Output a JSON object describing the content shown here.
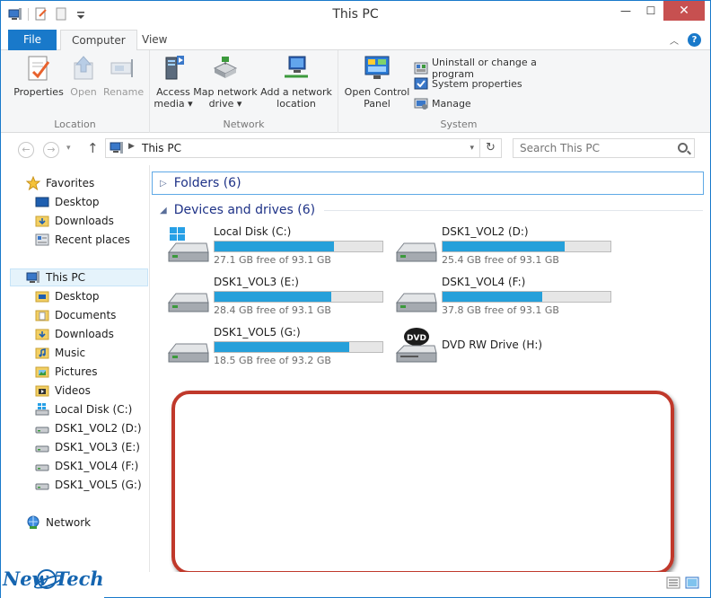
{
  "window": {
    "title": "This PC",
    "controls": {
      "minimize": "—",
      "maximize": "☐",
      "close": "✕"
    }
  },
  "ribbon_tabs": {
    "file": "File",
    "computer": "Computer",
    "view": "View",
    "help": "?"
  },
  "ribbon": {
    "location": {
      "label": "Location",
      "properties": "Properties",
      "open": "Open",
      "rename": "Rename"
    },
    "network": {
      "label": "Network",
      "access_media_line1": "Access",
      "access_media_line2": "media ▾",
      "map_drive_line1": "Map network",
      "map_drive_line2": "drive ▾",
      "add_location_line1": "Add a network",
      "add_location_line2": "location"
    },
    "system": {
      "label": "System",
      "control_panel_line1": "Open Control",
      "control_panel_line2": "Panel",
      "uninstall": "Uninstall or change a program",
      "system_properties": "System properties",
      "manage": "Manage"
    }
  },
  "address": {
    "crumb": "This PC",
    "search_placeholder": "Search This PC"
  },
  "nav": {
    "favorites": "Favorites",
    "desktop_fav": "Desktop",
    "downloads_fav": "Downloads",
    "recent": "Recent places",
    "this_pc": "This PC",
    "desktop": "Desktop",
    "documents": "Documents",
    "downloads": "Downloads",
    "music": "Music",
    "pictures": "Pictures",
    "videos": "Videos",
    "local_disk": "Local Disk (C:)",
    "vol2": "DSK1_VOL2 (D:)",
    "vol3": "DSK1_VOL3 (E:)",
    "vol4": "DSK1_VOL4 (F:)",
    "vol5": "DSK1_VOL5 (G:)",
    "network": "Network"
  },
  "content": {
    "folders_header": "Folders (6)",
    "devices_header": "Devices and drives (6)",
    "drives": [
      {
        "name": "Local Disk (C:)",
        "free": "27.1 GB free of 93.1 GB",
        "used_fraction": 0.709
      },
      {
        "name": "DSK1_VOL2 (D:)",
        "free": "25.4 GB free of 93.1 GB",
        "used_fraction": 0.727
      },
      {
        "name": "DSK1_VOL3 (E:)",
        "free": "28.4 GB free of 93.1 GB",
        "used_fraction": 0.695
      },
      {
        "name": "DSK1_VOL4 (F:)",
        "free": "37.8 GB free of 93.1 GB",
        "used_fraction": 0.594
      },
      {
        "name": "DSK1_VOL5 (G:)",
        "free": "18.5 GB free of 93.2 GB",
        "used_fraction": 0.801
      }
    ],
    "dvd": {
      "name": "DVD RW Drive (H:)",
      "label": "DVD"
    }
  },
  "watermark": {
    "left": "New",
    "right": "Tech"
  },
  "colors": {
    "accent": "#1979ca",
    "bar_fill": "#26a0da",
    "annotation": "#c0392b"
  }
}
